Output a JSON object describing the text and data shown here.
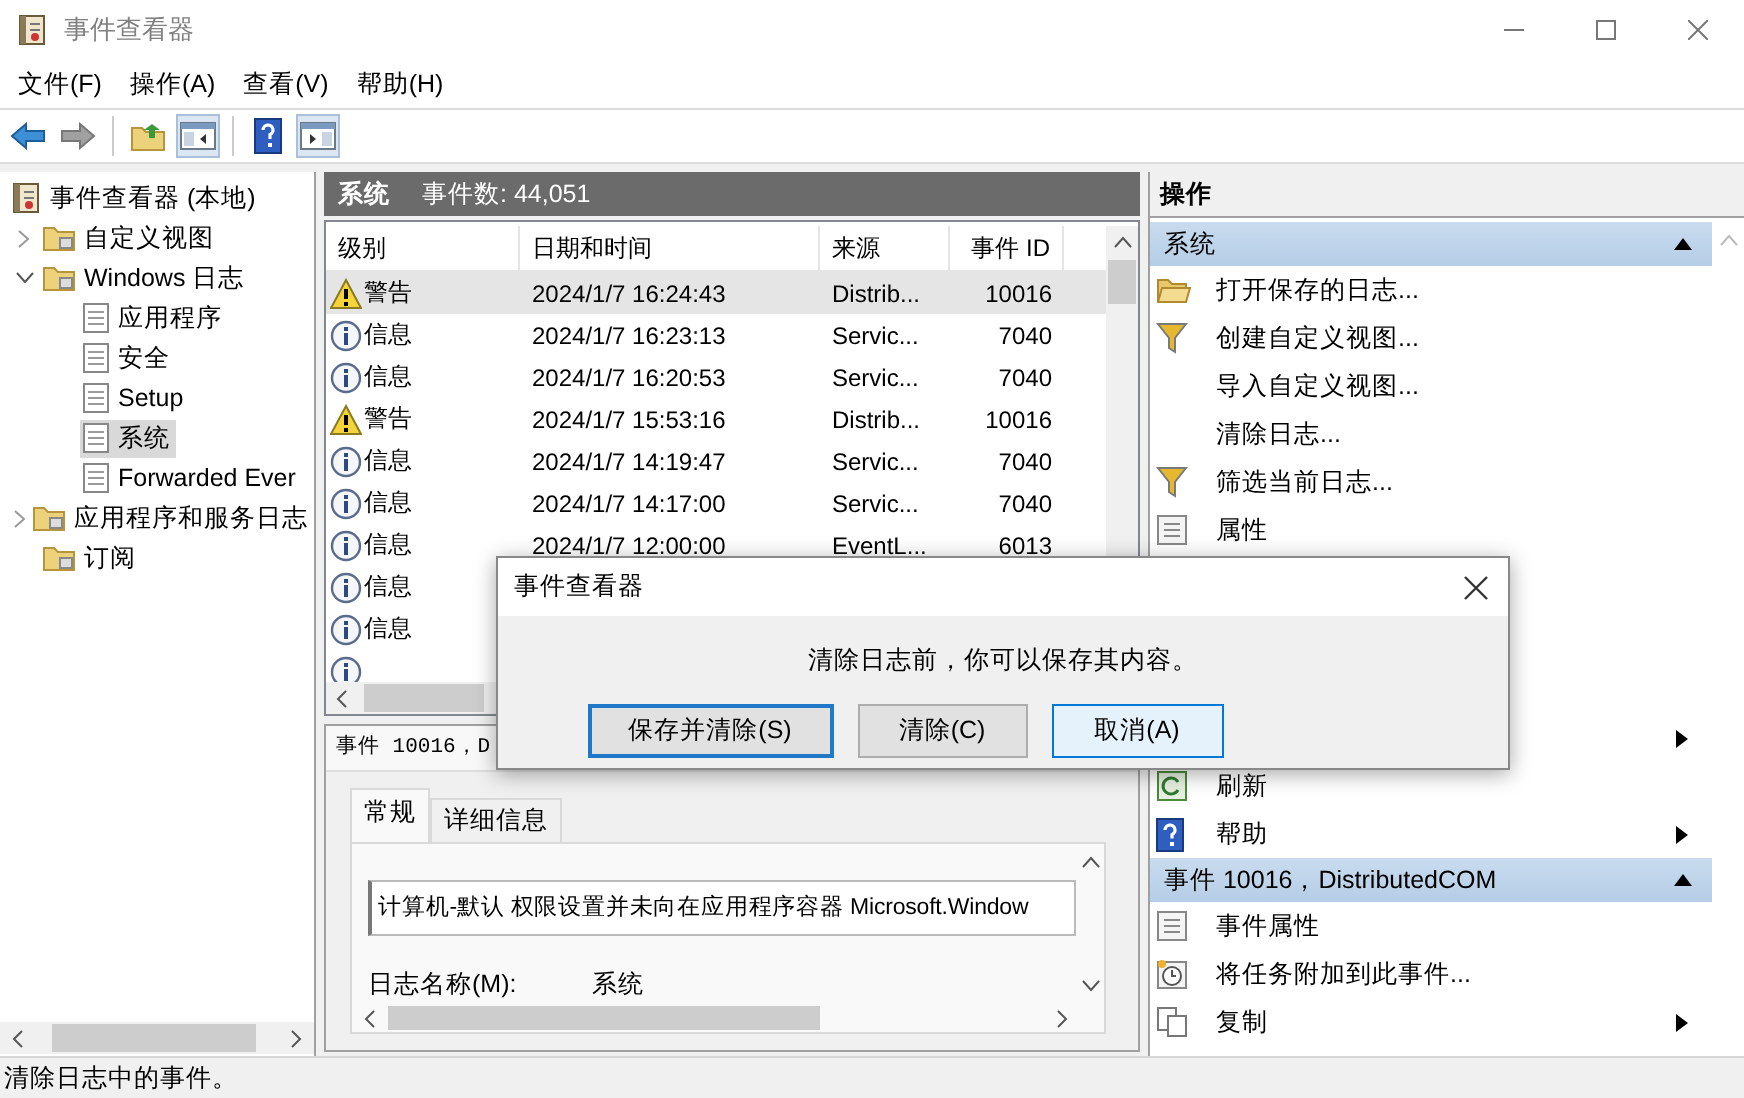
{
  "window": {
    "title": "事件查看器"
  },
  "menu": [
    "文件(F)",
    "操作(A)",
    "查看(V)",
    "帮助(H)"
  ],
  "toolbar": [
    {
      "kind": "back",
      "disabled": false
    },
    {
      "kind": "forward",
      "disabled": true
    },
    {
      "kind": "separator"
    },
    {
      "kind": "up-folder"
    },
    {
      "kind": "tree-pane",
      "pressed": true
    },
    {
      "kind": "separator"
    },
    {
      "kind": "help"
    },
    {
      "kind": "action-pane",
      "pressed": true
    }
  ],
  "tree": [
    {
      "label": "事件查看器 (本地)",
      "selected": false,
      "children": [
        {
          "label": "自定义视图",
          "expanded": false,
          "selected": false
        },
        {
          "label": "Windows 日志",
          "expanded": true,
          "selected": false,
          "children": [
            {
              "label": "应用程序",
              "selected": false
            },
            {
              "label": "安全",
              "selected": false
            },
            {
              "label": "Setup",
              "selected": false
            },
            {
              "label": "系统",
              "selected": true
            },
            {
              "label": "Forwarded Ever",
              "selected": false
            }
          ]
        },
        {
          "label": "应用程序和服务日志",
          "expanded": false,
          "selected": false
        },
        {
          "label": "订阅",
          "selected": false
        }
      ]
    }
  ],
  "list": {
    "title": "系统",
    "count": "事件数: 44,051",
    "columns": [
      "级别",
      "日期和时间",
      "来源",
      "事件 ID"
    ],
    "rows": [
      {
        "kind": "warning",
        "severity": "警告",
        "date": "2024/1/7 16:24:43",
        "source": "Distrib...",
        "event_id": "10016",
        "selected": true
      },
      {
        "kind": "info",
        "severity": "信息",
        "date": "2024/1/7 16:23:13",
        "source": "Servic...",
        "event_id": "7040",
        "selected": false
      },
      {
        "kind": "info",
        "severity": "信息",
        "date": "2024/1/7 16:20:53",
        "source": "Servic...",
        "event_id": "7040",
        "selected": false
      },
      {
        "kind": "warning",
        "severity": "警告",
        "date": "2024/1/7 15:53:16",
        "source": "Distrib...",
        "event_id": "10016",
        "selected": false
      },
      {
        "kind": "info",
        "severity": "信息",
        "date": "2024/1/7 14:19:47",
        "source": "Servic...",
        "event_id": "7040",
        "selected": false
      },
      {
        "kind": "info",
        "severity": "信息",
        "date": "2024/1/7 14:17:00",
        "source": "Servic...",
        "event_id": "7040",
        "selected": false
      },
      {
        "kind": "info",
        "severity": "信息",
        "date": "2024/1/7 12:00:00",
        "source": "EventL...",
        "event_id": "6013",
        "selected": false
      },
      {
        "kind": "info",
        "severity": "信息",
        "selected": false
      },
      {
        "kind": "info",
        "severity": "信息",
        "selected": false
      },
      {
        "kind": "info",
        "selected": false
      }
    ]
  },
  "detail": {
    "title": "事件 10016，D",
    "tabs": [
      {
        "label": "常规",
        "selected": true
      },
      {
        "label": "详细信息",
        "selected": false
      }
    ],
    "description": "计算机-默认 权限设置并未向在应用程序容器 Microsoft.Window",
    "fields": [
      {
        "label": "日志名称(M):",
        "value": "系统"
      }
    ]
  },
  "actions": {
    "title": "操作",
    "groups": [
      {
        "title": "系统",
        "expanded": true,
        "items": [
          {
            "kind": "open-folder",
            "label": "打开保存的日志...",
            "submenu": false
          },
          {
            "kind": "filter",
            "label": "创建自定义视图...",
            "submenu": false
          },
          {
            "kind": "none",
            "label": "导入自定义视图...",
            "submenu": false
          },
          {
            "kind": "none",
            "label": "清除日志...",
            "submenu": false
          },
          {
            "kind": "filter",
            "label": "筛选当前日志...",
            "submenu": false
          },
          {
            "kind": "properties",
            "label": "属性",
            "submenu": false
          },
          {
            "kind": "covered"
          },
          {
            "kind": "covered"
          },
          {
            "kind": "covered"
          },
          {
            "kind": "none",
            "submenu": true
          },
          {
            "kind": "refresh",
            "label": "刷新",
            "submenu": false
          },
          {
            "kind": "help",
            "label": "帮助",
            "submenu": true
          }
        ]
      },
      {
        "title": "事件 10016，DistributedCOM",
        "expanded": true,
        "items": [
          {
            "kind": "properties",
            "label": "事件属性",
            "submenu": false
          },
          {
            "kind": "task",
            "label": "将任务附加到此事件...",
            "submenu": false
          },
          {
            "kind": "copy",
            "label": "复制",
            "submenu": true
          }
        ]
      }
    ]
  },
  "dialog": {
    "title": "事件查看器",
    "message": "清除日志前，你可以保存其内容。",
    "buttons": [
      {
        "label": "保存并清除(S)",
        "default": true,
        "hovered": false
      },
      {
        "label": "清除(C)",
        "default": false,
        "hovered": false
      },
      {
        "label": "取消(A)",
        "default": false,
        "hovered": true
      }
    ]
  },
  "status_bar": "清除日志中的事件。"
}
